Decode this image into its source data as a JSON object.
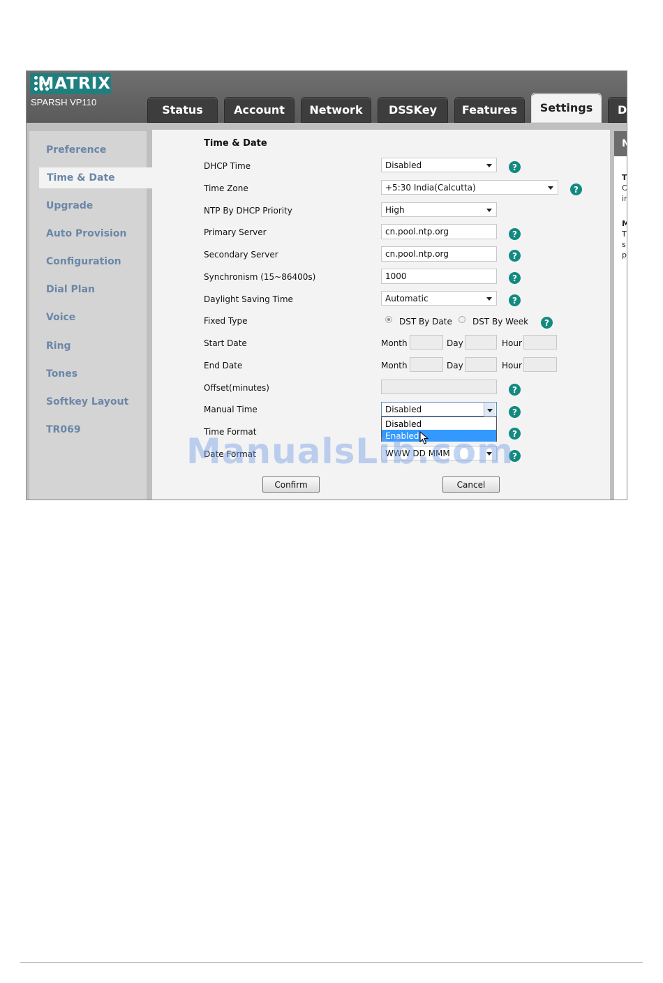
{
  "brand": {
    "logo": "MATRIX",
    "model": "SPARSH VP110"
  },
  "tabs": [
    "Status",
    "Account",
    "Network",
    "DSSKey",
    "Features",
    "Settings",
    "Di"
  ],
  "active_tab": "Settings",
  "sidebar": [
    "Preference",
    "Time & Date",
    "Upgrade",
    "Auto Provision",
    "Configuration",
    "Dial Plan",
    "Voice",
    "Ring",
    "Tones",
    "Softkey Layout",
    "TR069"
  ],
  "section_title": "Time & Date",
  "fields": {
    "dhcp_time": {
      "label": "DHCP Time",
      "value": "Disabled"
    },
    "time_zone": {
      "label": "Time Zone",
      "value": "+5:30 India(Calcutta)"
    },
    "ntp_priority": {
      "label": "NTP By DHCP Priority",
      "value": "High"
    },
    "primary_server": {
      "label": "Primary Server",
      "value": "cn.pool.ntp.org"
    },
    "secondary_server": {
      "label": "Secondary Server",
      "value": "cn.pool.ntp.org"
    },
    "synchronism": {
      "label": "Synchronism (15~86400s)",
      "value": "1000"
    },
    "dst": {
      "label": "Daylight Saving Time",
      "value": "Automatic"
    },
    "fixed_type": {
      "label": "Fixed Type",
      "opt1": "DST By Date",
      "opt2": "DST By Week"
    },
    "start_date": {
      "label": "Start Date"
    },
    "end_date": {
      "label": "End Date"
    },
    "date_parts": {
      "month": "Month",
      "day": "Day",
      "hour": "Hour"
    },
    "offset": {
      "label": "Offset(minutes)",
      "value": ""
    },
    "manual_time": {
      "label": "Manual Time",
      "value": "Disabled",
      "options": [
        "Disabled",
        "Enabled"
      ]
    },
    "time_format": {
      "label": "Time Format"
    },
    "date_format": {
      "label": "Date Format",
      "value": "WWW DD MMM"
    }
  },
  "buttons": {
    "confirm": "Confirm",
    "cancel": "Cancel"
  },
  "help_glyph": "?",
  "right_panel": {
    "header": "N",
    "lines": [
      "T",
      "C",
      "ir",
      "M",
      "T",
      "s",
      "p"
    ]
  },
  "watermark": "ManualsLib.com",
  "colors": {
    "accent_teal": "#138a80",
    "sidebar_text": "#6a87a8",
    "selection": "#3399ff"
  }
}
